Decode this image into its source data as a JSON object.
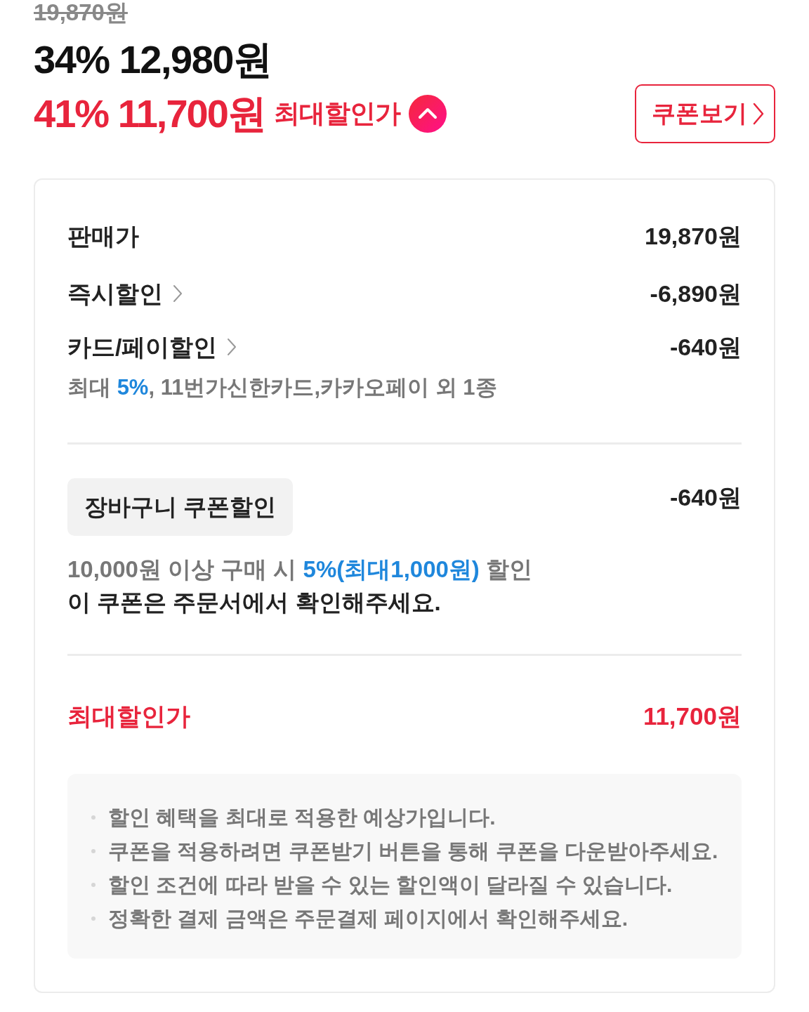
{
  "price_header": {
    "original_price": "19,870원",
    "sale_price": "34% 12,980원",
    "max_price": "41% 11,700원",
    "max_label": "최대할인가",
    "expanded": true,
    "coupon_button": "쿠폰보기"
  },
  "breakdown": {
    "rows": [
      {
        "label": "판매가",
        "amount": "19,870원",
        "linked": false
      },
      {
        "label": "즉시할인",
        "amount": "-6,890원",
        "linked": true
      },
      {
        "label": "카드/페이할인",
        "amount": "-640원",
        "linked": true,
        "detail": "최대 **5%**, 11번가신한카드,카카오페이 외 1종"
      }
    ]
  },
  "coupon": {
    "label": "장바구니 쿠폰할인",
    "amount": "-640원",
    "condition": "10,000원 이상 구매 시 **5%(최대1,000원)** 할인",
    "note": "이 쿠폰은 주문서에서 확인해주세요."
  },
  "total": {
    "label": "최대할인가",
    "amount": "11,700원"
  },
  "notes": [
    "할인 혜택을 최대로 적용한 예상가입니다.",
    "쿠폰을 적용하려면 쿠폰받기 버튼을 통해 쿠폰을 다운받아주세요.",
    "할인 조건에 따라 받을 수 있는 할인액이 달라질 수 있습니다.",
    "정확한 결제 금액은 주문결제 페이지에서 확인해주세요."
  ]
}
